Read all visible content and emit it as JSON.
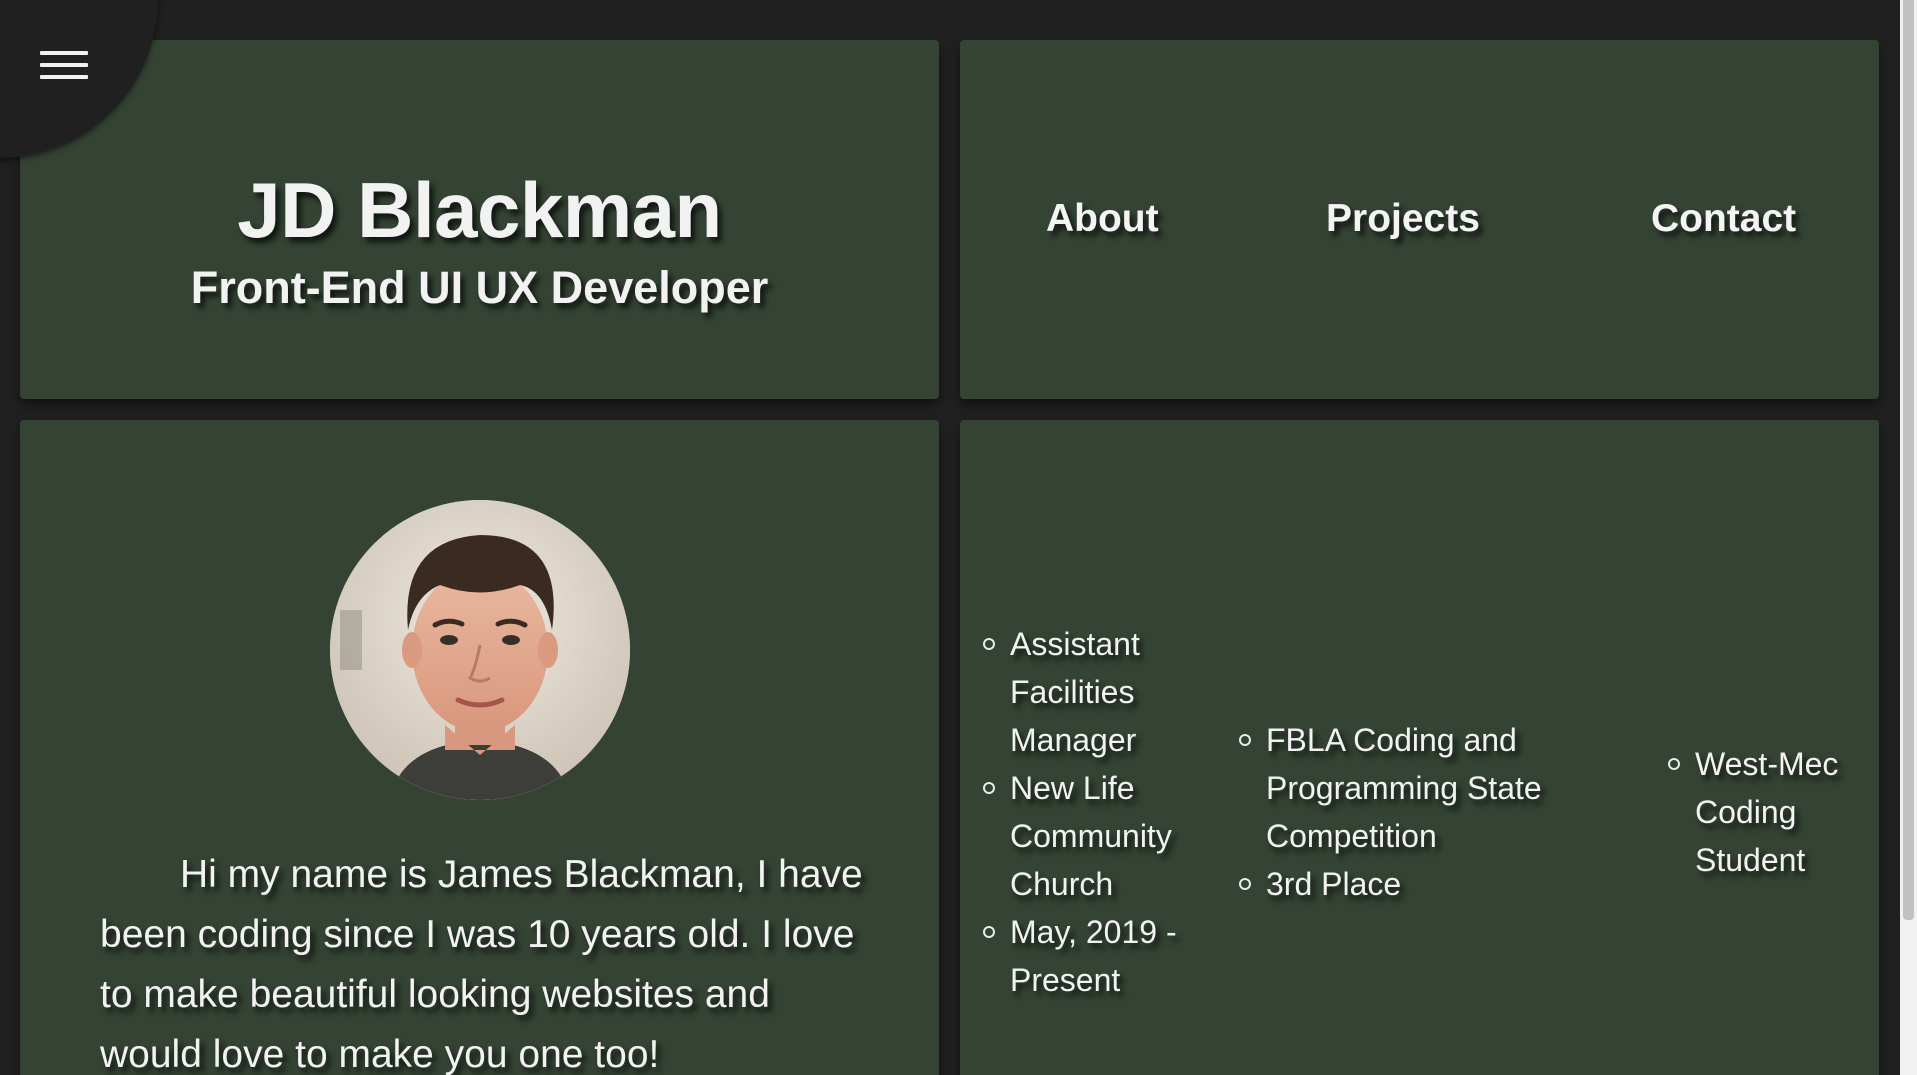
{
  "header": {
    "title": "JD Blackman",
    "subtitle": "Front-End UI UX Developer"
  },
  "nav": {
    "about": "About",
    "projects": "Projects",
    "contact": "Contact"
  },
  "menu": {
    "icon": "hamburger-menu-icon"
  },
  "about": {
    "bio": "Hi my name is James Blackman, I have been coding since I was 10 years old. I love to make beautiful looking websites and would love to make you one too!"
  },
  "resume": {
    "job": [
      "Assistant Facilities Manager",
      "New Life Community Church",
      "May, 2019 - Present"
    ],
    "award": [
      "FBLA Coding and Programming State Competition",
      "3rd Place"
    ],
    "school": [
      "West-Mec Coding Student"
    ]
  },
  "colors": {
    "background": "#202020",
    "card": "#344334",
    "text": "#f2f2f2"
  }
}
